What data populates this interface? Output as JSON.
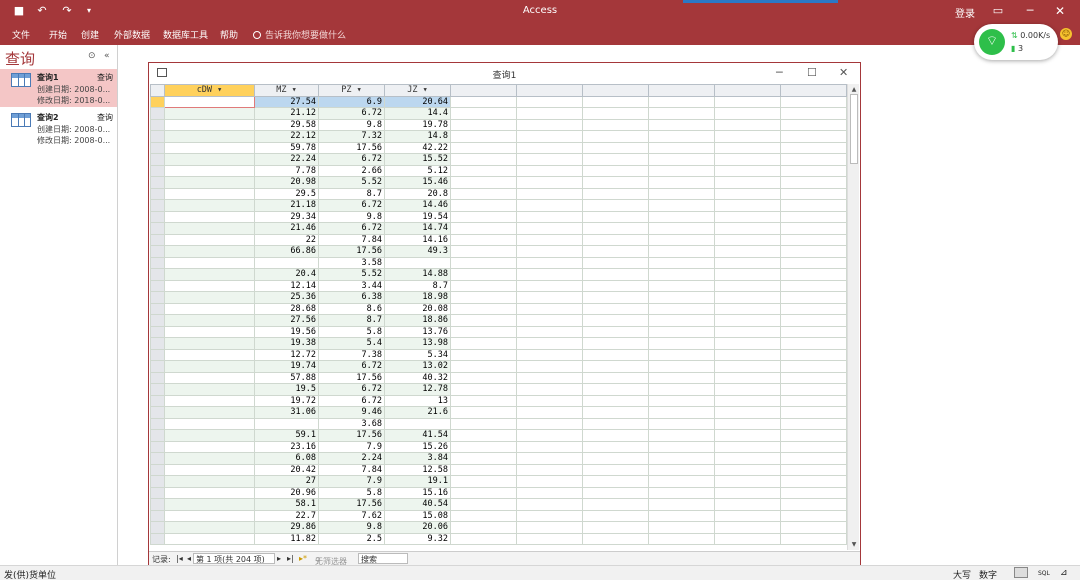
{
  "app": {
    "title": "Access",
    "login": "登录"
  },
  "ribbon": {
    "tabs": [
      "文件",
      "开始",
      "创建",
      "外部数据",
      "数据库工具",
      "帮助"
    ],
    "tellme": "告诉我你想要做什么"
  },
  "nav": {
    "title": "查询",
    "items": [
      {
        "name": "查询1",
        "type": "查询",
        "created": "创建日期: 2008-0...",
        "modified": "修改日期: 2018-0..."
      },
      {
        "name": "查询2",
        "type": "查询",
        "created": "创建日期: 2008-0...",
        "modified": "修改日期: 2008-0..."
      }
    ]
  },
  "window": {
    "title": "查询1"
  },
  "grid": {
    "columns": [
      "cDW",
      "MZ",
      "PZ",
      "JZ"
    ],
    "rows": [
      [
        "",
        "27.54",
        "6.9",
        "20.64"
      ],
      [
        "",
        "21.12",
        "6.72",
        "14.4"
      ],
      [
        "",
        "29.58",
        "9.8",
        "19.78"
      ],
      [
        "",
        "22.12",
        "7.32",
        "14.8"
      ],
      [
        "",
        "59.78",
        "17.56",
        "42.22"
      ],
      [
        "",
        "22.24",
        "6.72",
        "15.52"
      ],
      [
        "",
        "7.78",
        "2.66",
        "5.12"
      ],
      [
        "",
        "20.98",
        "5.52",
        "15.46"
      ],
      [
        "",
        "29.5",
        "8.7",
        "20.8"
      ],
      [
        "",
        "21.18",
        "6.72",
        "14.46"
      ],
      [
        "",
        "29.34",
        "9.8",
        "19.54"
      ],
      [
        "",
        "21.46",
        "6.72",
        "14.74"
      ],
      [
        "",
        "22",
        "7.84",
        "14.16"
      ],
      [
        "",
        "66.86",
        "17.56",
        "49.3"
      ],
      [
        "",
        "",
        "3.58",
        ""
      ],
      [
        "",
        "20.4",
        "5.52",
        "14.88"
      ],
      [
        "",
        "12.14",
        "3.44",
        "8.7"
      ],
      [
        "",
        "25.36",
        "6.38",
        "18.98"
      ],
      [
        "",
        "28.68",
        "8.6",
        "20.08"
      ],
      [
        "",
        "27.56",
        "8.7",
        "18.86"
      ],
      [
        "",
        "19.56",
        "5.8",
        "13.76"
      ],
      [
        "",
        "19.38",
        "5.4",
        "13.98"
      ],
      [
        "",
        "12.72",
        "7.38",
        "5.34"
      ],
      [
        "",
        "19.74",
        "6.72",
        "13.02"
      ],
      [
        "",
        "57.88",
        "17.56",
        "40.32"
      ],
      [
        "",
        "19.5",
        "6.72",
        "12.78"
      ],
      [
        "",
        "19.72",
        "6.72",
        "13"
      ],
      [
        "",
        "31.06",
        "9.46",
        "21.6"
      ],
      [
        "",
        "",
        "3.68",
        ""
      ],
      [
        "",
        "59.1",
        "17.56",
        "41.54"
      ],
      [
        "",
        "23.16",
        "7.9",
        "15.26"
      ],
      [
        "",
        "6.08",
        "2.24",
        "3.84"
      ],
      [
        "",
        "20.42",
        "7.84",
        "12.58"
      ],
      [
        "",
        "27",
        "7.9",
        "19.1"
      ],
      [
        "",
        "20.96",
        "5.8",
        "15.16"
      ],
      [
        "",
        "58.1",
        "17.56",
        "40.54"
      ],
      [
        "",
        "22.7",
        "7.62",
        "15.08"
      ],
      [
        "",
        "29.86",
        "9.8",
        "20.06"
      ],
      [
        "",
        "11.82",
        "2.5",
        "9.32"
      ]
    ]
  },
  "record_nav": {
    "label": "记录:",
    "position": "第 1 项(共 204 项)",
    "filter": "无筛选器",
    "search": "搜索"
  },
  "status": {
    "left": "发(供)货单位",
    "caps": "大写",
    "num": "数字",
    "sql": "SQL"
  },
  "network": {
    "speed": "0.00K/s",
    "count": "3"
  }
}
